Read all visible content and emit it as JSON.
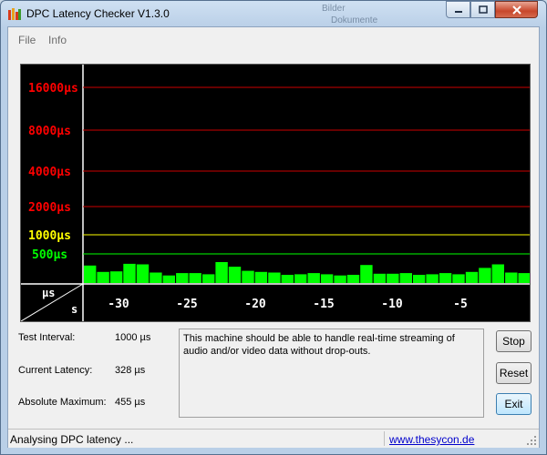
{
  "window": {
    "title": "DPC Latency Checker V1.3.0",
    "background_hint_top": "Dokumente",
    "background_hint_top2": "Bilder"
  },
  "menu": [
    {
      "label": "File"
    },
    {
      "label": "Info"
    }
  ],
  "graph": {
    "y_labels": [
      {
        "text": "16000µs",
        "color": "#ff0000"
      },
      {
        "text": "8000µs",
        "color": "#ff0000"
      },
      {
        "text": "4000µs",
        "color": "#ff0000"
      },
      {
        "text": "2000µs",
        "color": "#ff0000"
      },
      {
        "text": "1000µs",
        "color": "#ffff00"
      },
      {
        "text": "500µs",
        "color": "#00ff00"
      }
    ],
    "corner_top": "µs",
    "corner_bottom": "s",
    "x_labels": [
      "-30",
      "-25",
      "-20",
      "-15",
      "-10",
      "-5"
    ],
    "bar_color": "#00ff00",
    "bar_levels_us": [
      300,
      190,
      200,
      330,
      320,
      180,
      130,
      170,
      170,
      150,
      360,
      280,
      210,
      190,
      180,
      140,
      150,
      170,
      150,
      130,
      140,
      310,
      160,
      160,
      170,
      140,
      150,
      170,
      150,
      190,
      260,
      320,
      180,
      170
    ]
  },
  "info": {
    "test_interval_label": "Test Interval:",
    "test_interval_value": "1000 µs",
    "current_latency_label": "Current Latency:",
    "current_latency_value": "328 µs",
    "absolute_max_label": "Absolute Maximum:",
    "absolute_max_value": "455 µs"
  },
  "message": "This machine should be able to handle real-time streaming of audio and/or video data without drop-outs.",
  "buttons": {
    "stop": "Stop",
    "reset": "Reset",
    "exit": "Exit"
  },
  "status": {
    "text": "Analysing DPC latency ...",
    "link": "www.thesycon.de"
  }
}
